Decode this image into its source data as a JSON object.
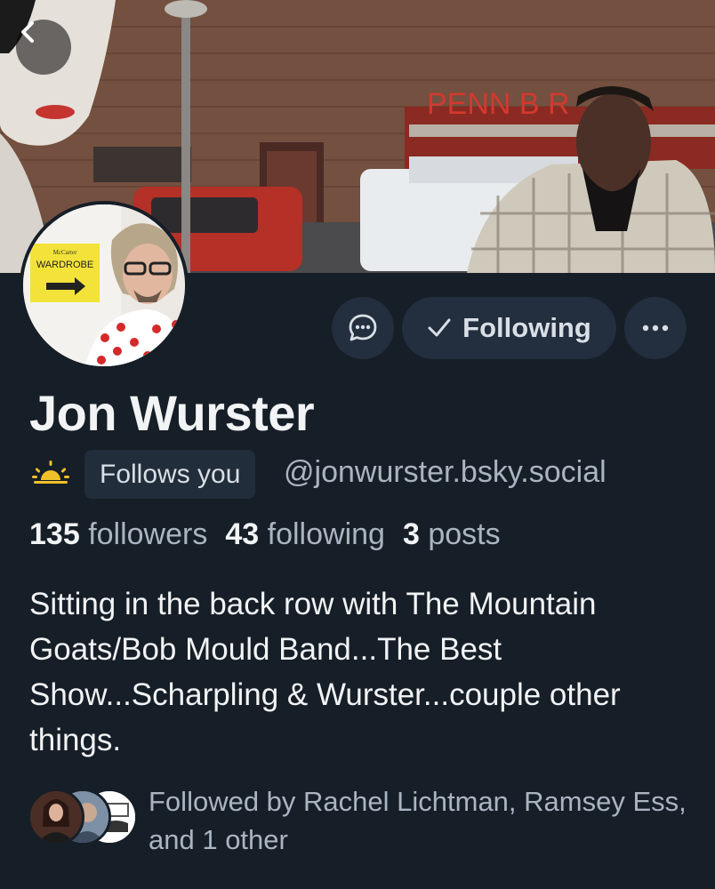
{
  "profile": {
    "display_name": "Jon Wurster",
    "follows_you_label": "Follows you",
    "handle": "@jonwurster.bsky.social",
    "followers_count": "135",
    "followers_label": "followers",
    "following_count": "43",
    "following_label": "following",
    "posts_count": "3",
    "posts_label": "posts",
    "bio": "Sitting in the back row with The Mountain Goats/Bob Mould Band...The Best Show...Scharpling & Wurster...couple other things.",
    "followed_by": "Followed by Rachel Lichtman, Ramsey Ess, and 1 other"
  },
  "actions": {
    "following_label": "Following"
  },
  "banner": {
    "sign_text": "PENN B    R",
    "avatar_sign_small": "McCarter",
    "avatar_sign_text": "WARDROBE"
  },
  "icons": {
    "back": "chevron-left-icon",
    "message": "chat-bubble-icon",
    "check": "check-icon",
    "more": "ellipsis-icon",
    "status": "sunrise-icon"
  },
  "colors": {
    "background": "#161e27",
    "button_bg": "#232e3e",
    "muted_text": "#aab5c2",
    "primary_text": "#f1f3f5"
  }
}
